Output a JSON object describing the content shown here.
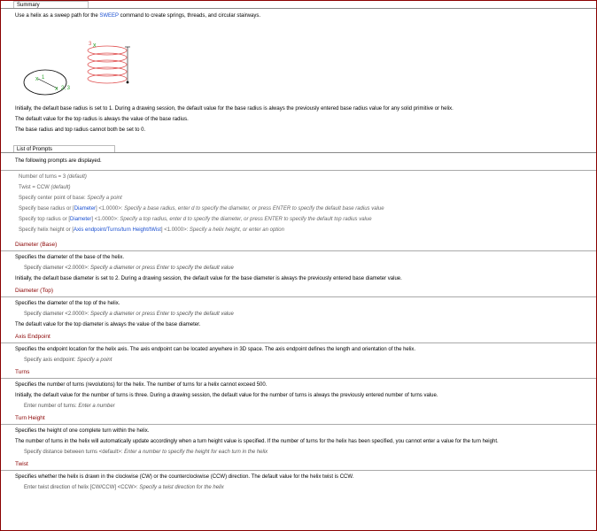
{
  "summary_tab": "Summary",
  "summary_intro": {
    "prefix": "Use a helix as a sweep path for the ",
    "command": "SWEEP",
    "suffix": " command to create springs, threads, and circular stairways."
  },
  "figure_labels": {
    "top": "3",
    "a": "1",
    "b": "2, 3"
  },
  "summary_paras": [
    "Initially, the default base radius is set to 1. During a drawing session, the default value for the base radius is always the previously entered base radius value for any solid primitive or helix.",
    "The default value for the top radius is always the value of the base radius.",
    "The base radius and top radius cannot both be set to 0."
  ],
  "prompts_tab": "List of Prompts",
  "prompts_intro": "The following prompts are displayed.",
  "prompts": [
    {
      "text": "Number of turns = 3 ",
      "italic": "(default)"
    },
    {
      "text": "Twist = CCW ",
      "italic": "(default)"
    },
    {
      "text": "Specify center point of base: ",
      "italic": "Specify a point"
    },
    {
      "pre": "Specify base radius or [",
      "kw": "Diameter",
      "post": "] <1.0000>: ",
      "italic": "Specify a base radius, enter d to specify the diameter, or press ENTER to specify the default base radius value"
    },
    {
      "pre": "Specify top radius or [",
      "kw": "Diameter",
      "post": "] <1.0000>: ",
      "italic": "Specify a top radius, enter d to specify the diameter, or press ENTER to specify the default top radius value"
    },
    {
      "pre": "Specify helix height or [",
      "kw": "Axis endpoint/Turns/turn Height/tWist",
      "post": "] <1.0000>: ",
      "italic": "Specify a helix height, or enter an option"
    }
  ],
  "sections": [
    {
      "title": "Diameter (Base)",
      "lead": "Specifies the diameter of the base of the helix.",
      "sub": {
        "text": "Specify diameter <2.0000>: ",
        "italic": "Specify a diameter or press Enter to specify the default value"
      },
      "after": [
        "Initially, the default base diameter is set to 2. During a drawing session, the default value for the base diameter is always the previously entered base diameter value."
      ]
    },
    {
      "title": "Diameter (Top)",
      "lead": "Specifies the diameter of the top of the helix.",
      "sub": {
        "text": "Specify diameter <2.0000>: ",
        "italic": "Specify a diameter or press Enter to specify the default value"
      },
      "after": [
        "The default value for the top diameter is always the value of the base diameter."
      ]
    },
    {
      "title": "Axis Endpoint",
      "lead": "Specifies the endpoint location for the helix axis. The axis endpoint can be located anywhere in 3D space. The axis endpoint defines the length and orientation of the helix.",
      "sub": {
        "text": "Specify axis endpoint: ",
        "italic": "Specify a point"
      },
      "after": []
    },
    {
      "title": "Turns",
      "lead": "Specifies the number of turns (revolutions) for the helix. The number of turns for a helix cannot exceed 500.",
      "mid": [
        "Initially, the default value for the number of turns is three. During a drawing session, the default value for the number of turns is always the previously entered number of turns value."
      ],
      "sub": {
        "text": "Enter number of turns: ",
        "italic": "Enter a number"
      },
      "after": []
    },
    {
      "title": "Turn Height",
      "lead": "Specifies the height of one complete turn within the helix.",
      "mid": [
        "The number of turns in the helix will automatically update accordingly when a turn height value is specified. If the number of turns for the helix has been specified, you cannot enter a value for the turn height."
      ],
      "sub": {
        "text": "Specify distance between turns <default>: ",
        "italic": "Enter a number to specify the height for each turn in the helix"
      },
      "after": []
    },
    {
      "title": "Twist",
      "lead": "Specifies whether the helix is drawn in the clockwise (CW) or the counterclockwise (CCW) direction. The default value for the helix twist is CCW.",
      "sub": {
        "text": "Enter twist direction of helix [CW/CCW] <CCW>: ",
        "italic": "Specify a twist direction for the helix"
      },
      "after": []
    }
  ],
  "colors": {
    "accent": "#8a0000",
    "keyword": "#1a4fd0",
    "helix": "#e05050",
    "marker": "#2aa02a"
  }
}
